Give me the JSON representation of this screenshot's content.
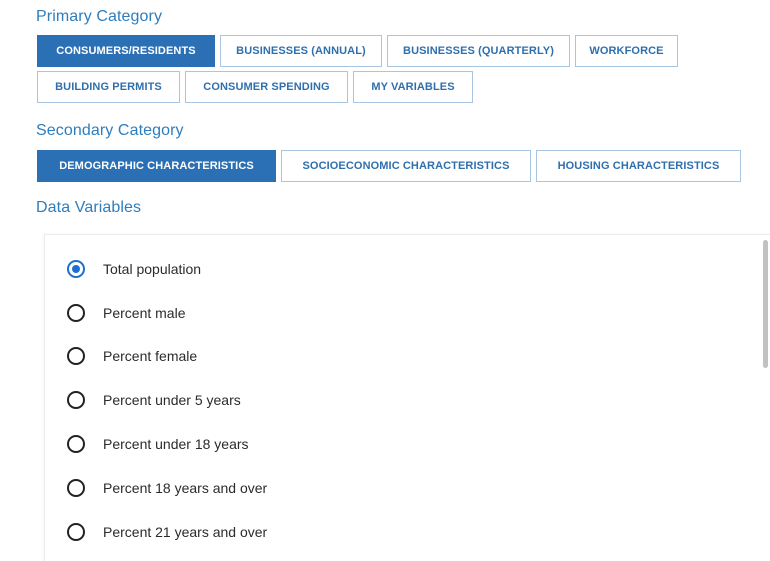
{
  "primary": {
    "title": "Primary Category",
    "tabs": [
      {
        "label": "CONSUMERS/RESIDENTS",
        "active": true
      },
      {
        "label": "BUSINESSES (ANNUAL)",
        "active": false
      },
      {
        "label": "BUSINESSES (QUARTERLY)",
        "active": false
      },
      {
        "label": "WORKFORCE",
        "active": false
      },
      {
        "label": "BUILDING PERMITS",
        "active": false
      },
      {
        "label": "CONSUMER SPENDING",
        "active": false
      },
      {
        "label": "MY VARIABLES",
        "active": false
      }
    ]
  },
  "secondary": {
    "title": "Secondary Category",
    "tabs": [
      {
        "label": "DEMOGRAPHIC CHARACTERISTICS",
        "active": true
      },
      {
        "label": "SOCIOECONOMIC CHARACTERISTICS",
        "active": false
      },
      {
        "label": "HOUSING CHARACTERISTICS",
        "active": false
      }
    ]
  },
  "variables": {
    "title": "Data Variables",
    "options": [
      {
        "label": "Total population",
        "selected": true
      },
      {
        "label": "Percent male",
        "selected": false
      },
      {
        "label": "Percent female",
        "selected": false
      },
      {
        "label": "Percent under 5 years",
        "selected": false
      },
      {
        "label": "Percent under 18 years",
        "selected": false
      },
      {
        "label": "Percent 18 years and over",
        "selected": false
      },
      {
        "label": "Percent 21 years and over",
        "selected": false
      }
    ]
  },
  "colors": {
    "accent": "#2b70b5",
    "title": "#2e7dbd",
    "radio_selected": "#1f6fd1"
  }
}
